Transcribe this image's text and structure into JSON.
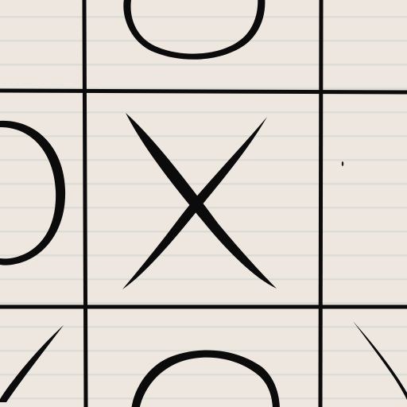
{
  "game": {
    "board_size": 3,
    "cells": [
      [
        "",
        "O",
        ""
      ],
      [
        "O",
        "X",
        ""
      ],
      [
        "X",
        "O",
        "X"
      ]
    ]
  },
  "colors": {
    "paper": "#ede7df",
    "ruled_line": "#8cabab",
    "ink": "#0b0b0b"
  }
}
